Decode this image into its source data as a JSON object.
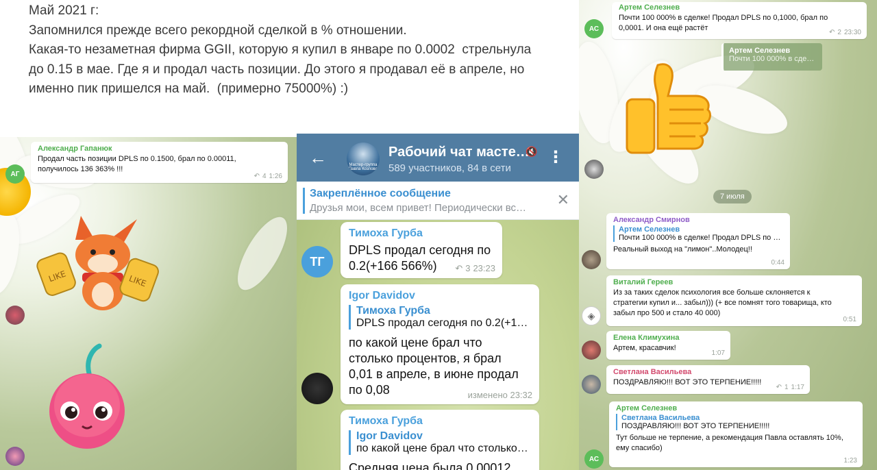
{
  "document": {
    "lines": [
      "Май 2021 г:",
      "Запомнился прежде всего рекордной сделкой в % отношении.",
      "Какая-то незаметная фирма GGII, которую я купил в январе по 0.0002  стрельнула",
      "до 0.15 в мае. Где я и продал часть позиции. До этого я продавал её в апреле, но",
      "именно пик пришелся на май.  (примерно 75000%) :)"
    ]
  },
  "left_chat": {
    "msg1": {
      "sender": "Александр Гапанюк",
      "text": "Продал часть позиции DPLS по 0.1500, брал по 0.00011, получилось 136 363% !!!",
      "replies": "4",
      "time": "1:26",
      "avatar_initials": "АГ",
      "sender_color": "#4fae4e"
    }
  },
  "middle_chat": {
    "header": {
      "title": "Рабочий чат масте…",
      "subtitle": "589 участников, 84 в сети",
      "avatar_caption": "Мастер-группа Павла Козлова"
    },
    "pinned": {
      "title": "Закреплённое сообщение",
      "text": "Друзья мои, всем привет! Периодически вс…"
    },
    "messages": [
      {
        "sender": "Тимоха Гурба",
        "sender_color": "#4aa0dc",
        "text": "DPLS продал сегодня по 0.2(+166 566%)",
        "replies": "3",
        "time": "23:23",
        "avatar_initials": "ТГ"
      },
      {
        "sender": "Igor Davidov",
        "sender_color": "#4aa0dc",
        "reply_to": "Тимоха Гурба",
        "reply_text": "DPLS продал сегодня по 0.2(+16…",
        "text": "по какой цене брал что столько процентов, я брал 0,01 в апреле, в июне продал по 0,08",
        "time": "изменено 23:32"
      },
      {
        "sender": "Тимоха Гурба",
        "sender_color": "#4aa0dc",
        "reply_to": "Igor Davidov",
        "reply_text": "по какой цене брал что столько…",
        "text": "Средняя цена была 0,00012"
      }
    ]
  },
  "right_chat": {
    "msg_top": {
      "sender": "Артем Селезнев",
      "sender_color": "#4fae4e",
      "text": "Почти 100 000% в сделке! Продал DPLS по 0,1000, брал по 0,0001. И она ещё растёт",
      "replies": "2",
      "time": "23:30",
      "avatar_initials": "АС"
    },
    "quote_chip": {
      "sender": "Артем Селезнев",
      "text": "Почти 100 000% в сде…"
    },
    "date": "7 июля",
    "messages": [
      {
        "sender": "Александр Смирнов",
        "sender_color": "#8e5cc7",
        "reply_to": "Артем Селезнев",
        "reply_text": "Почти 100 000% в сделке! Продал DPLS по …",
        "text": "Реальный выход на \"лимон\"..Молодец!!",
        "time": "0:44"
      },
      {
        "sender": "Виталий Гереев",
        "sender_color": "#4fae4e",
        "text": "Из за таких сделок психология все больше склоняется к стратегии купил и... забыл))) (+ все помнят того товарища, кто забыл про 500 и стало 40 000)",
        "time": "0:51"
      },
      {
        "sender": "Елена Климухина",
        "sender_color": "#4fae4e",
        "text": "Артем, красавчик!",
        "time": "1:07"
      },
      {
        "sender": "Светлана Васильева",
        "sender_color": "#d2496d",
        "text": "ПОЗДРАВЛЯЮ!!!   ВОТ ЭТО ТЕРПЕНИЕ!!!!!",
        "replies": "1",
        "time": "1:17"
      },
      {
        "sender": "Артем Селезнев",
        "sender_color": "#4fae4e",
        "reply_to": "Светлана Васильева",
        "reply_text": "ПОЗДРАВЛЯЮ!!!   ВОТ ЭТО ТЕРПЕНИЕ!!!!!",
        "text": "Тут больше не терпение, а рекомендация Павла оставлять 10%, ему спасибо)",
        "time": "1:23",
        "avatar_initials": "АС"
      }
    ]
  },
  "icons": {
    "reply": "reply-arrow-icon",
    "back": "back-arrow-icon",
    "mute": "mute-icon",
    "more": "more-vertical-icon",
    "close": "close-icon"
  },
  "colors": {
    "telegram_header": "#517da2",
    "link_blue": "#3a8fd0",
    "green_avatar": "#5cbd5a",
    "blue_avatar": "#4aa0dc"
  }
}
